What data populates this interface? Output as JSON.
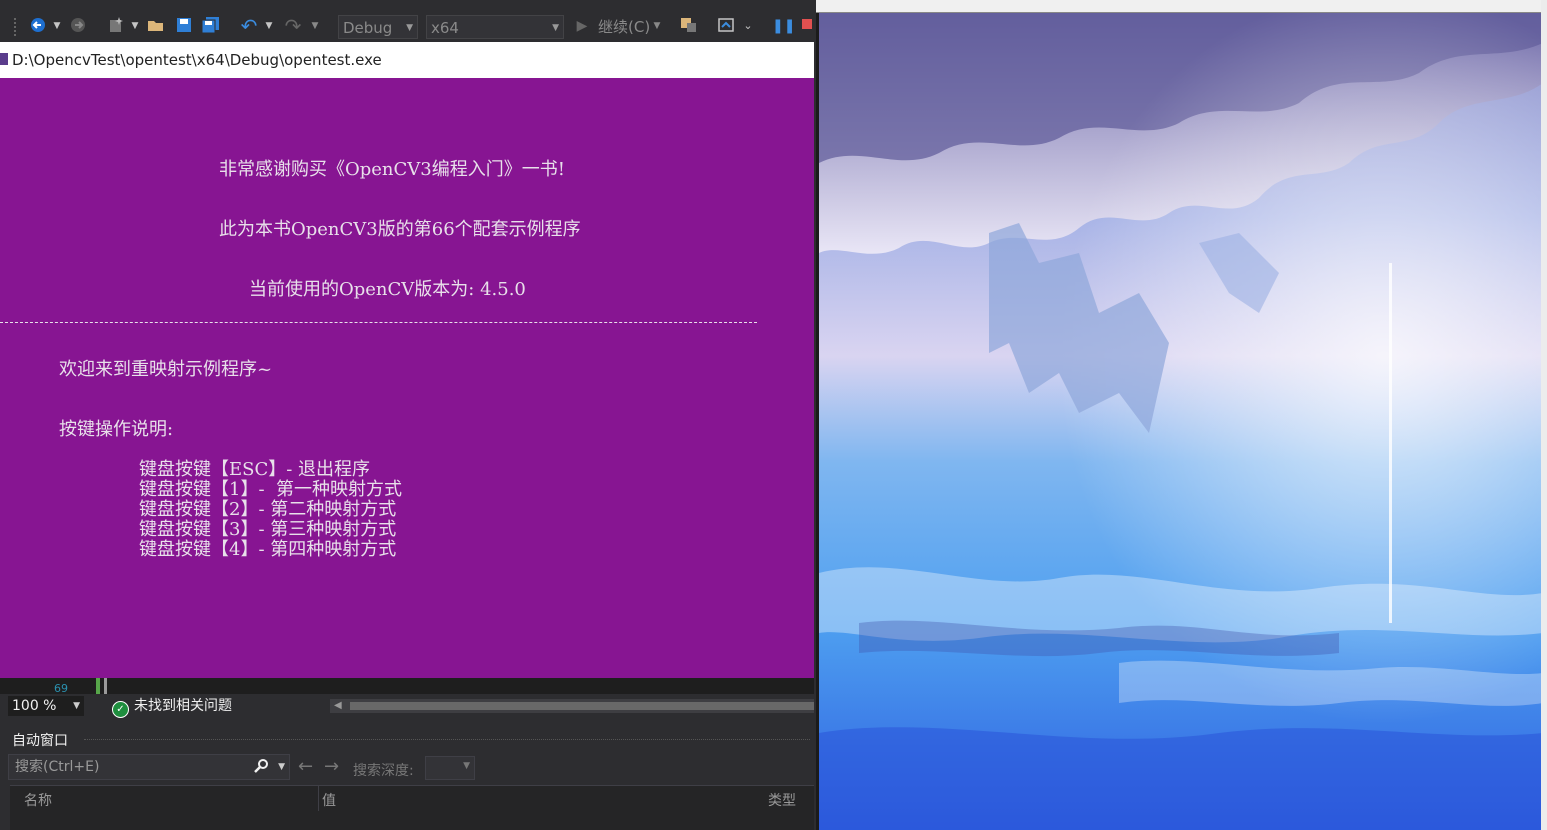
{
  "toolbar": {
    "config_dropdown": "Debug",
    "platform_dropdown": "x64",
    "continue_label": "继续(C)"
  },
  "console": {
    "title": "D:\\OpencvTest\\opentest\\x64\\Debug\\opentest.exe",
    "lines": [
      "非常感谢购买《OpenCV3编程入门》一书!",
      "此为本书OpenCV3版的第66个配套示例程序",
      "当前使用的OpenCV版本为: 4.5.0",
      "欢迎来到重映射示例程序~",
      "按键操作说明:",
      "键盘按键【ESC】- 退出程序",
      "键盘按键【1】-  第一种映射方式",
      "键盘按键【2】- 第二种映射方式",
      "键盘按键【3】- 第三种映射方式",
      "键盘按键【4】- 第四种映射方式"
    ]
  },
  "editor": {
    "line_number": "69",
    "zoom": "100 %",
    "issues_status": "未找到相关问题"
  },
  "autos": {
    "title": "自动窗口",
    "search_placeholder": "搜索(Ctrl+E)",
    "depth_label": "搜索深度:",
    "columns": [
      "名称",
      "值",
      "类型"
    ]
  },
  "colors": {
    "console_bg": "#871592",
    "vs_bg": "#2d2d30"
  }
}
